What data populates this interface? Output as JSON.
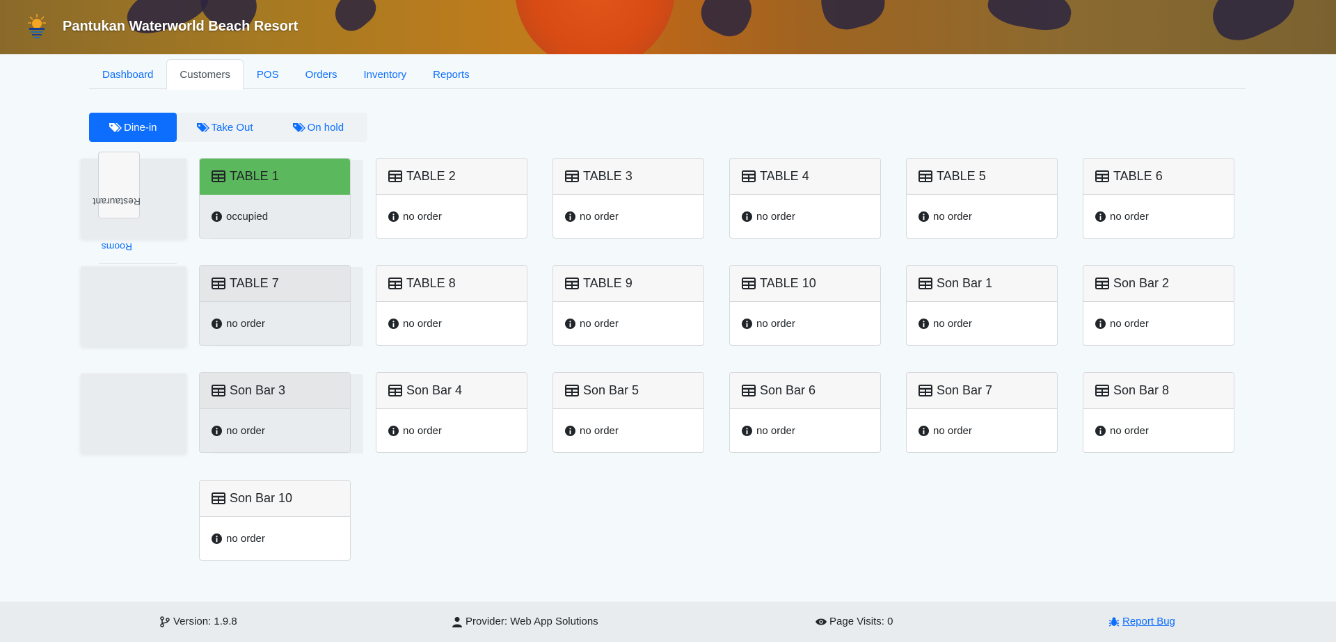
{
  "app": {
    "title": "Pantukan Waterworld Beach Resort"
  },
  "tabs": [
    {
      "label": "Dashboard",
      "active": false
    },
    {
      "label": "Customers",
      "active": true
    },
    {
      "label": "POS",
      "active": false
    },
    {
      "label": "Orders",
      "active": false
    },
    {
      "label": "Inventory",
      "active": false
    },
    {
      "label": "Reports",
      "active": false
    }
  ],
  "order_types": [
    {
      "label": "Dine-in",
      "active": true,
      "icon": "tags-icon"
    },
    {
      "label": "Take Out",
      "active": false,
      "icon": "tags-icon"
    },
    {
      "label": "On hold",
      "active": false,
      "icon": "tags-icon"
    }
  ],
  "side": {
    "restaurant_label": "Restaurant",
    "rooms_label": "Rooms"
  },
  "tables": [
    {
      "name": "TABLE 1",
      "status": "occupied",
      "occupied": true
    },
    {
      "name": "TABLE 2",
      "status": "no order",
      "occupied": false
    },
    {
      "name": "TABLE 3",
      "status": "no order",
      "occupied": false
    },
    {
      "name": "TABLE 4",
      "status": "no order",
      "occupied": false
    },
    {
      "name": "TABLE 5",
      "status": "no order",
      "occupied": false
    },
    {
      "name": "TABLE 6",
      "status": "no order",
      "occupied": false
    },
    {
      "name": "TABLE 7",
      "status": "no order",
      "occupied": false
    },
    {
      "name": "TABLE 8",
      "status": "no order",
      "occupied": false
    },
    {
      "name": "TABLE 9",
      "status": "no order",
      "occupied": false
    },
    {
      "name": "TABLE 10",
      "status": "no order",
      "occupied": false
    },
    {
      "name": "Son Bar 1",
      "status": "no order",
      "occupied": false
    },
    {
      "name": "Son Bar 2",
      "status": "no order",
      "occupied": false
    },
    {
      "name": "Son Bar 3",
      "status": "no order",
      "occupied": false
    },
    {
      "name": "Son Bar 4",
      "status": "no order",
      "occupied": false
    },
    {
      "name": "Son Bar 5",
      "status": "no order",
      "occupied": false
    },
    {
      "name": "Son Bar 6",
      "status": "no order",
      "occupied": false
    },
    {
      "name": "Son Bar 7",
      "status": "no order",
      "occupied": false
    },
    {
      "name": "Son Bar 8",
      "status": "no order",
      "occupied": false
    },
    {
      "name": "Son Bar 10",
      "status": "no order",
      "occupied": false
    }
  ],
  "footer": {
    "version": "Version: 1.9.8",
    "provider": "Provider: Web App Solutions",
    "visits": "Page Visits: 0",
    "report_bug": "Report Bug"
  },
  "colors": {
    "accent": "#0d6efd",
    "occupied": "#5cb85c",
    "footer_bg": "#e9ecef"
  }
}
